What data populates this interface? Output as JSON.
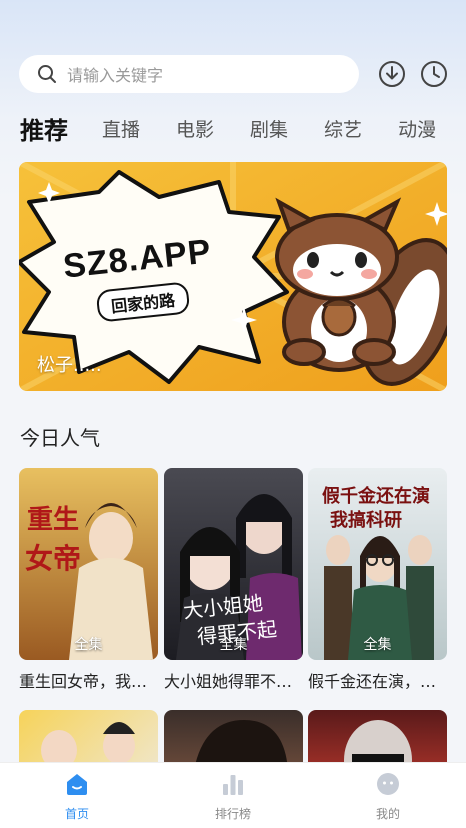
{
  "search": {
    "placeholder": "请输入关键字"
  },
  "header_icons": [
    "download-icon",
    "history-icon"
  ],
  "tabs": [
    {
      "label": "推荐",
      "active": true
    },
    {
      "label": "直播",
      "active": false
    },
    {
      "label": "电影",
      "active": false
    },
    {
      "label": "剧集",
      "active": false
    },
    {
      "label": "综艺",
      "active": false
    },
    {
      "label": "动漫",
      "active": false
    }
  ],
  "banner": {
    "brand": "SZ8.APP",
    "subtitle": "回家的路",
    "caption": "松子....."
  },
  "section": {
    "title": "今日人气"
  },
  "cards": [
    {
      "title": "重生回女帝，我…",
      "badge": "全集",
      "poster_text": "重生回女帝"
    },
    {
      "title": "大小姐她得罪不…",
      "badge": "全集",
      "poster_text": "大小姐她得罪不起"
    },
    {
      "title": "假千金还在演，…",
      "badge": "全集",
      "poster_text": "假千金还在演 我搞科研"
    }
  ],
  "bottom_nav": [
    {
      "label": "首页",
      "icon": "home-icon",
      "active": true
    },
    {
      "label": "排行榜",
      "icon": "ranking-icon",
      "active": false
    },
    {
      "label": "我的",
      "icon": "profile-icon",
      "active": false
    }
  ],
  "colors": {
    "accent": "#2e8ef0",
    "banner": "#f3b224"
  }
}
